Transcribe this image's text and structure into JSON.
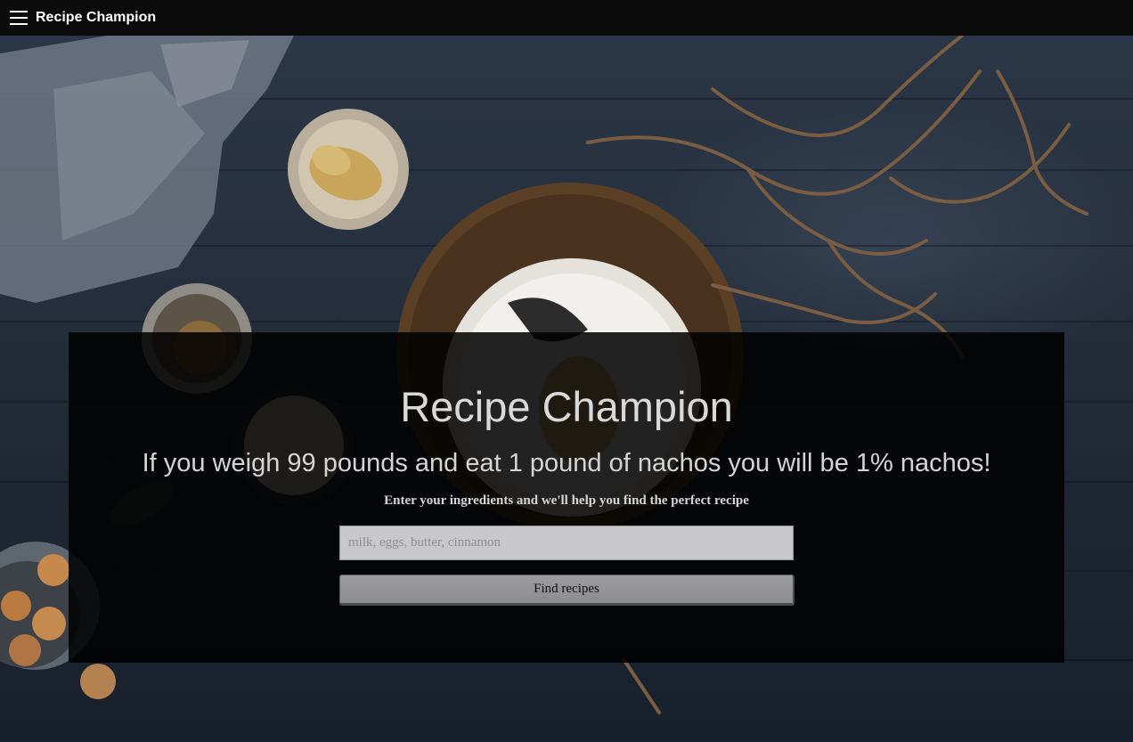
{
  "navbar": {
    "menu_icon": "hamburger-menu-icon",
    "brand": "Recipe Champion"
  },
  "hero": {
    "title": "Recipe Champion",
    "tagline": "If you weigh 99 pounds and eat 1 pound of nachos you will be 1% nachos!",
    "instructions": "Enter your ingredients and we'll help you find the perfect recipe",
    "search": {
      "placeholder": "milk, eggs, butter, cinnamon",
      "value": ""
    },
    "button_label": "Find recipes"
  },
  "colors": {
    "navbar_bg": "#0b0b0b",
    "overlay_bg": "#000000",
    "title_text": "#d9d9d9",
    "input_bg": "#c8c8ca",
    "button_bg": "#8c8c8e"
  }
}
